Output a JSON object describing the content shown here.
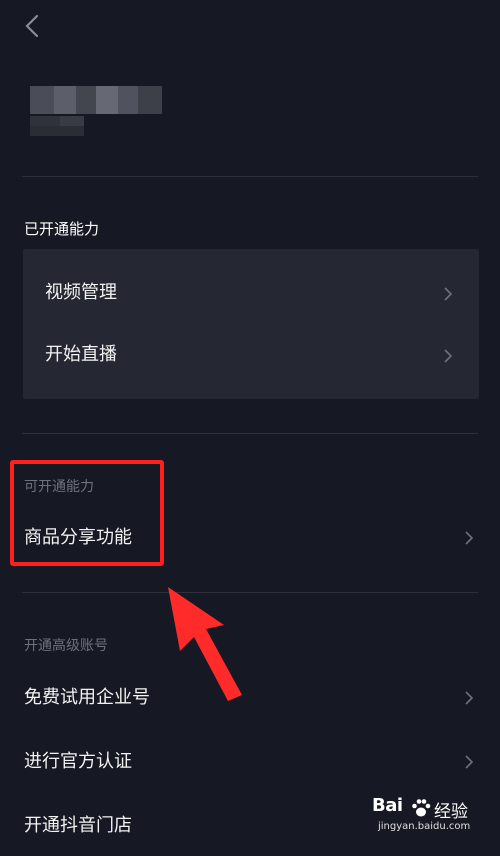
{
  "header": {
    "back_icon": "chevron-left-icon"
  },
  "opened": {
    "title": "已开通能力",
    "items": [
      {
        "label": "视频管理"
      },
      {
        "label": "开始直播"
      }
    ]
  },
  "available": {
    "title": "可开通能力",
    "items": [
      {
        "label": "商品分享功能"
      }
    ]
  },
  "advanced": {
    "title": "开通高级账号",
    "items": [
      {
        "label": "免费试用企业号"
      },
      {
        "label": "进行官方认证"
      },
      {
        "label": "开通抖音门店"
      }
    ]
  },
  "watermark": {
    "brand": "Bai",
    "suffix": "经验",
    "url": "jingyan.baidu.com"
  },
  "colors": {
    "background": "#161823",
    "card": "#252732",
    "highlight": "#ff1f1f",
    "muted": "#6f717c"
  }
}
